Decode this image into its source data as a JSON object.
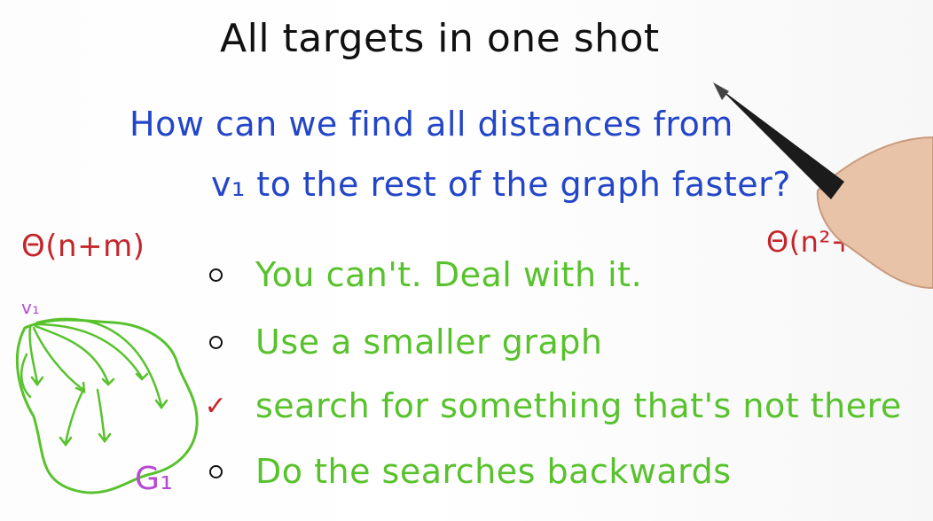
{
  "slide": {
    "title": "All targets in one shot",
    "question_line1": "How can we find all distances from",
    "question_line2": "v₁ to the rest of the graph faster?",
    "complexity_left": "Θ(n+m)",
    "complexity_right": "Θ(n²+nm)",
    "options": [
      {
        "text": "You can't. Deal with it.",
        "selected": false
      },
      {
        "text": "Use a smaller graph",
        "selected": false
      },
      {
        "text": "search for something that's not there",
        "selected": true
      },
      {
        "text": "Do the searches backwards",
        "selected": false
      }
    ],
    "graph_labels": {
      "vertex": "v₁",
      "graph": "G₁"
    }
  },
  "colors": {
    "title": "#111111",
    "question": "#2346c9",
    "complexity": "#c4252a",
    "options": "#58c22d",
    "graph": "#58c22d",
    "labels": "#b54ad1"
  },
  "icons": {
    "unselected_bullet": "circle-bullet-icon",
    "selected_bullet": "checkmark-icon",
    "pen": "pen-icon"
  }
}
